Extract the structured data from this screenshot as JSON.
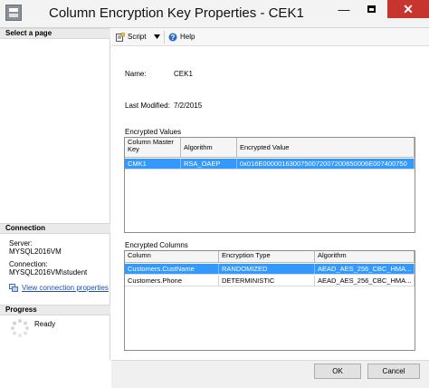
{
  "window": {
    "title": "Column Encryption Key Properties - CEK1"
  },
  "titlebar_buttons": {
    "minimize": "—",
    "close": "✕"
  },
  "left_panel": {
    "select_page_header": "Select a page",
    "connection_header": "Connection",
    "server_label": "Server:",
    "server_value": "MYSQL2016VM",
    "connection_label": "Connection:",
    "connection_value": "MYSQL2016VM\\student",
    "view_link": "View connection properties",
    "progress_header": "Progress",
    "progress_status": "Ready"
  },
  "toolbar": {
    "script_label": "Script",
    "help_label": "Help"
  },
  "properties": {
    "name_label": "Name:",
    "name_value": "CEK1",
    "modified_label": "Last Modified:",
    "modified_value": "7/2/2015"
  },
  "encrypted_values": {
    "label": "Encrypted Values",
    "columns": [
      "Column Master Key",
      "Algorithm",
      "Encrypted Value"
    ],
    "rows": [
      [
        "CMK1",
        "RSA_OAEP",
        "0x016E0000016300750072007200650006E007400750"
      ]
    ]
  },
  "encrypted_columns": {
    "label": "Encrypted Columns",
    "columns": [
      "Column",
      "Encryption Type",
      "Algorithm"
    ],
    "rows": [
      [
        "Customers.CustName",
        "RANDOMIZED",
        "AEAD_AES_256_CBC_HMA..."
      ],
      [
        "Customers.Phone",
        "DETERMINISTIC",
        "AEAD_AES_256_CBC_HMA..."
      ]
    ]
  },
  "footer": {
    "ok_label": "OK",
    "cancel_label": "Cancel"
  },
  "colors": {
    "selection": "#3399ff",
    "close_button": "#c7352e",
    "link": "#1a4fa8"
  }
}
